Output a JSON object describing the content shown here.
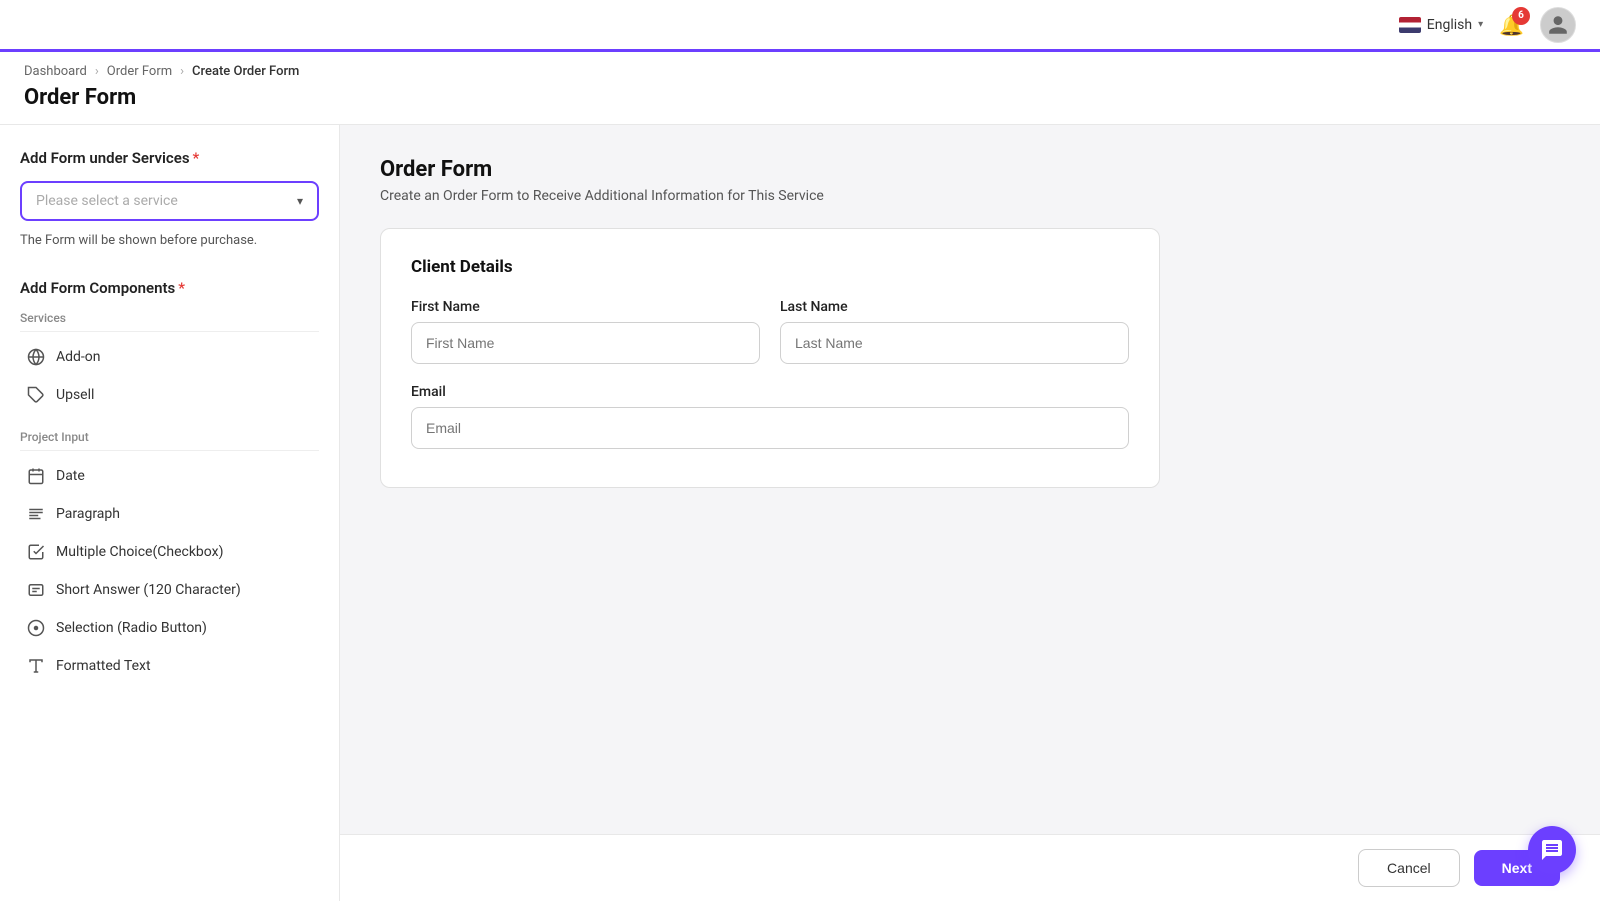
{
  "topbar": {
    "language": "English",
    "notification_count": "6"
  },
  "breadcrumb": {
    "items": [
      {
        "label": "Dashboard",
        "link": true
      },
      {
        "label": "Order Form",
        "link": true
      },
      {
        "label": "Create Order Form",
        "link": false
      }
    ]
  },
  "page_title": "Order Form",
  "sidebar": {
    "add_form_label": "Add Form under Services",
    "select_placeholder": "Please select a service",
    "helper_text": "The Form will be shown before purchase.",
    "add_components_label": "Add Form Components",
    "categories": [
      {
        "name": "Services",
        "items": [
          {
            "label": "Add-on",
            "icon": "globe"
          },
          {
            "label": "Upsell",
            "icon": "tag"
          }
        ]
      },
      {
        "name": "Project Input",
        "items": [
          {
            "label": "Date",
            "icon": "calendar"
          },
          {
            "label": "Paragraph",
            "icon": "list"
          },
          {
            "label": "Multiple Choice(Checkbox)",
            "icon": "checkbox"
          },
          {
            "label": "Short Answer (120 Character)",
            "icon": "short-text"
          },
          {
            "label": "Selection (Radio Button)",
            "icon": "radio"
          },
          {
            "label": "Formatted Text",
            "icon": "formatted"
          }
        ]
      }
    ]
  },
  "form_preview": {
    "title": "Order Form",
    "description": "Create an Order Form to Receive Additional Information for This Service",
    "card": {
      "section_title": "Client Details",
      "fields": [
        {
          "id": "first_name",
          "label": "First Name",
          "placeholder": "First Name",
          "type": "text",
          "row": 1
        },
        {
          "id": "last_name",
          "label": "Last Name",
          "placeholder": "Last Name",
          "type": "text",
          "row": 1
        },
        {
          "id": "email",
          "label": "Email",
          "placeholder": "Email",
          "type": "email",
          "row": 2
        }
      ]
    }
  },
  "actions": {
    "cancel_label": "Cancel",
    "next_label": "Next"
  }
}
